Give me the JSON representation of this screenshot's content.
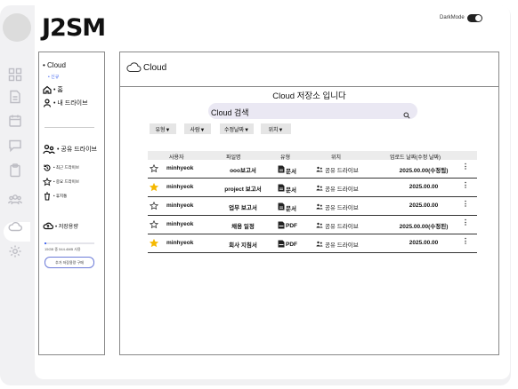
{
  "app": {
    "logo": "J2SM",
    "darkmode_label": "DarkMode"
  },
  "rail": {
    "icons": [
      "grid-icon",
      "document-icon",
      "calendar-icon",
      "chat-icon",
      "clipboard-icon",
      "users-icon",
      "cloud-icon",
      "gear-icon"
    ],
    "active": "cloud-icon"
  },
  "sidebar": {
    "cloud_label": "• Cloud",
    "new_label": "• 신규",
    "home_label": "• 홈",
    "my_drive_label": "• 내 드라이브",
    "shared_drive_label": "• 공유 드라이브",
    "recent_label": "• 최근 드라이브",
    "important_label": "• 중요 드라이브",
    "trash_label": "• 휴지통",
    "storage_label": "• 저장용량",
    "storage_text": "15GB 중 544.4MB 사용",
    "storage_fraction": 0.04,
    "buy_button": "추가 저장용량 구매"
  },
  "content": {
    "header_title": "Cloud",
    "store_title": "Cloud 저장소 입니다",
    "search_placeholder": "Cloud 검색",
    "filters": [
      "유형▼",
      "사람▼",
      "수정날짜▼",
      "위치▼"
    ],
    "table": {
      "headers": {
        "user": "사용자",
        "file": "파일명",
        "type": "유형",
        "location": "위치",
        "date": "업로드 날짜(수정 날짜)"
      },
      "rows": [
        {
          "starred": false,
          "user": "minhyeok",
          "file": "ooo보고서",
          "type": "문서",
          "location": "공유 드라이브",
          "date": "2025.00.00(수정됨)"
        },
        {
          "starred": true,
          "user": "minhyeok",
          "file": "project 보고서",
          "type": "문서",
          "location": "공유 드라이브",
          "date": "2025.00.00"
        },
        {
          "starred": false,
          "user": "minhyeok",
          "file": "업무 보고서",
          "type": "문서",
          "location": "공유 드라이브",
          "date": "2025.00.00"
        },
        {
          "starred": false,
          "user": "minhyeok",
          "file": "채용 일정",
          "type": "PDF",
          "location": "공유 드라이브",
          "date": "2025.00.00(수정된)"
        },
        {
          "starred": true,
          "user": "minhyeok",
          "file": "회사 지침서",
          "type": "PDF",
          "location": "공유 드라이브",
          "date": "2025.00.00"
        }
      ]
    }
  },
  "colors": {
    "accent": "#4a6cf0",
    "star": "#f5b800",
    "search_bg": "#eae8f3"
  }
}
